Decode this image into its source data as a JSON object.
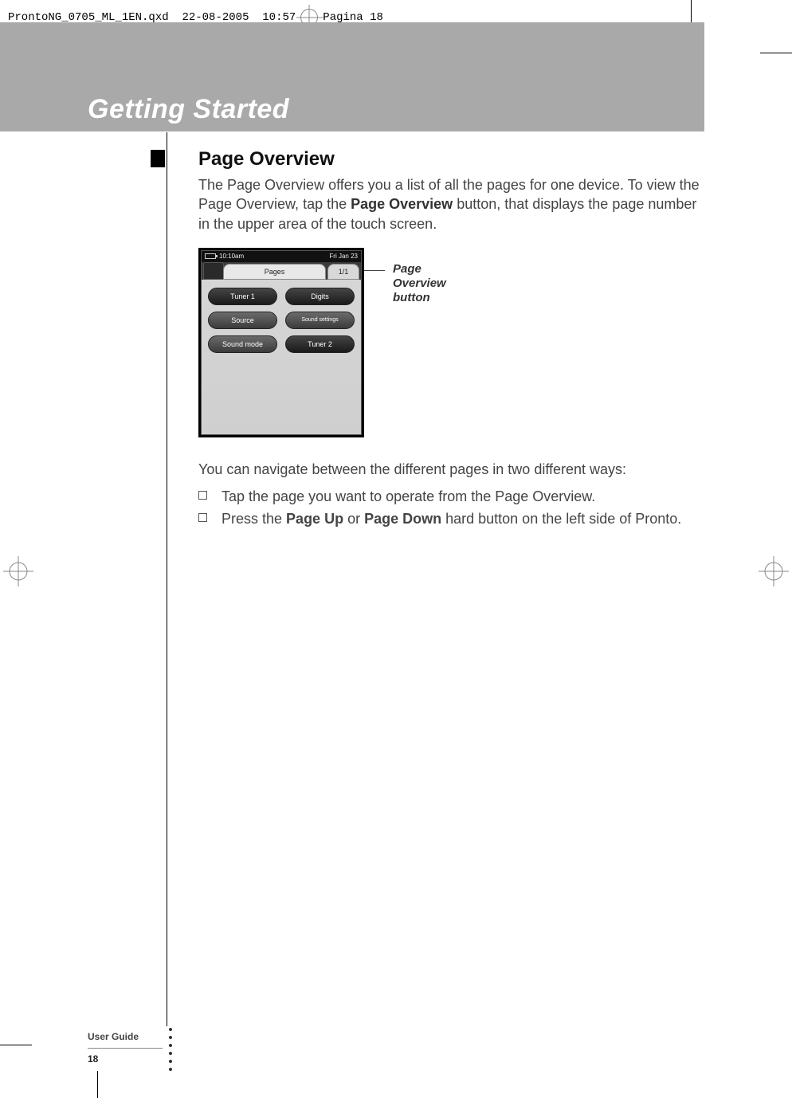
{
  "header": {
    "filename": "ProntoNG_0705_ML_1EN.qxd",
    "date": "22-08-2005",
    "time": "10:57",
    "pagina": "Pagina 18"
  },
  "banner": {
    "title": "Getting Started"
  },
  "section": {
    "heading": "Page Overview",
    "intro_pre": "The Page Overview offers you a list of all the pages for one device. To view the Page Overview, tap the ",
    "intro_bold": "Page Overview",
    "intro_post": " button, that displays the page number in the upper area of the touch screen."
  },
  "device_screen": {
    "status": {
      "time": "10:10am",
      "date": "Fri Jan 23"
    },
    "tabs": {
      "pages": "Pages",
      "pagenum": "1/1"
    },
    "buttons": {
      "tuner1": "Tuner 1",
      "digits": "Digits",
      "source": "Source",
      "sound_settings": "Sound settings",
      "sound_mode": "Sound mode",
      "tuner2": "Tuner 2"
    }
  },
  "callout": {
    "line1": "Page",
    "line2": "Overview",
    "line3": "button"
  },
  "paragraph2": "You can navigate between the different pages in two different ways:",
  "bullets": [
    {
      "pre": "Tap the page you want to operate from the Page Overview.",
      "bold1": "",
      "mid": "",
      "bold2": "",
      "post": ""
    },
    {
      "pre": "Press the ",
      "bold1": "Page Up",
      "mid": " or ",
      "bold2": "Page Down",
      "post": " hard button on the left side of Pronto."
    }
  ],
  "footer": {
    "label": "User Guide",
    "page": "18"
  }
}
